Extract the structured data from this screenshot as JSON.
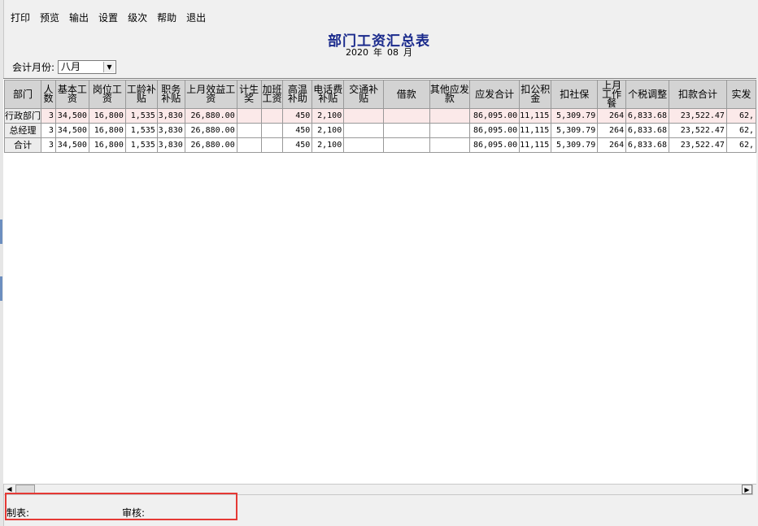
{
  "toolbar": {
    "print": "打印",
    "preview": "预览",
    "export": "输出",
    "settings": "设置",
    "level": "级次",
    "help": "帮助",
    "exit": "退出"
  },
  "report": {
    "title": "部门工资汇总表",
    "year": "2020",
    "year_unit": "年",
    "month": "08",
    "month_unit": "月"
  },
  "filter": {
    "label": "会计月份:",
    "selected": "八月"
  },
  "table": {
    "columns": [
      "部门",
      "人数",
      "基本工资",
      "岗位工资",
      "工龄补贴",
      "职务补贴",
      "上月效益工资",
      "计生奖",
      "加班工资",
      "高温补助",
      "电话费补贴",
      "交通补贴",
      "借款",
      "其他应发款",
      "应发合计",
      "扣公积金",
      "扣社保",
      "上月工作餐",
      "个税调整",
      "扣款合计",
      "实发"
    ],
    "rows": [
      [
        "行政部门",
        "3",
        "34,500",
        "16,800",
        "1,535",
        "3,830",
        "26,880.00",
        "",
        "",
        "450",
        "2,100",
        "",
        "",
        "",
        "86,095.00",
        "11,115",
        "5,309.79",
        "264",
        "6,833.68",
        "23,522.47",
        "62,"
      ],
      [
        "总经理",
        "3",
        "34,500",
        "16,800",
        "1,535",
        "3,830",
        "26,880.00",
        "",
        "",
        "450",
        "2,100",
        "",
        "",
        "",
        "86,095.00",
        "11,115",
        "5,309.79",
        "264",
        "6,833.68",
        "23,522.47",
        "62,"
      ],
      [
        "合计",
        "3",
        "34,500",
        "16,800",
        "1,535",
        "3,830",
        "26,880.00",
        "",
        "",
        "450",
        "2,100",
        "",
        "",
        "",
        "86,095.00",
        "11,115",
        "5,309.79",
        "264",
        "6,833.68",
        "23,522.47",
        "62,"
      ]
    ]
  },
  "footer": {
    "maker_label": "制表:",
    "auditor_label": "审核:"
  }
}
